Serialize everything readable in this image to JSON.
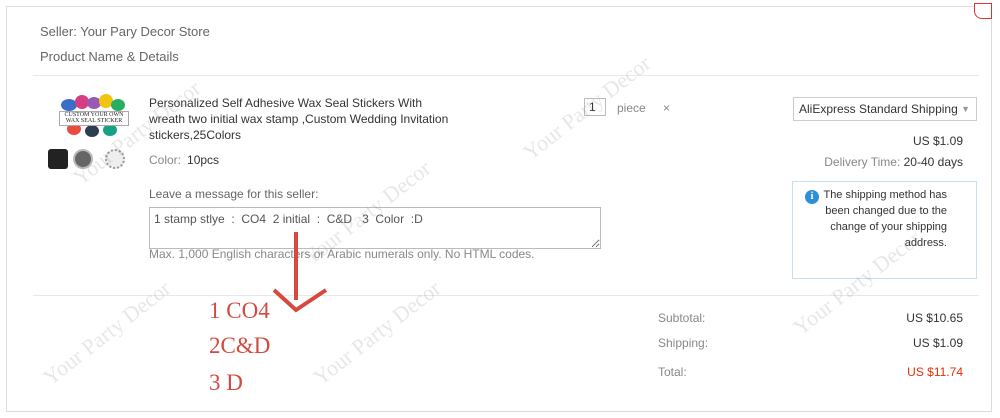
{
  "order": {
    "seller_label": "Seller: Your Pary Decor Store",
    "product_header": "Product Name & Details",
    "title": "Personalized Self Adhesive Wax Seal Stickers With wreath two initial wax stamp ,Custom Wedding Invitation stickers,25Colors",
    "thumb_label": "CUSTOM YOUR OWN WAX SEAL STICKER",
    "color_label": "Color:",
    "color_value": "10pcs",
    "quantity": "1",
    "unit": "piece",
    "times": "×",
    "leave_message_label": "Leave a message for this seller:",
    "message": "1 stamp stlye  :  CO4  2 initial  :  C&D   3  Color  :D",
    "max_note": "Max. 1,000 English characters or Arabic numerals only. No HTML codes.",
    "shipping_method": "AliExpress Standard Shipping",
    "shipping_price": "US $1.09",
    "delivery_label": "Delivery Time:",
    "delivery_value": "20-40 days",
    "notice": "The shipping method has been changed due to the change of your shipping address.",
    "subtotal_label": "Subtotal:",
    "subtotal_value": "US $10.65",
    "shipping_label": "Shipping:",
    "shipping_value": "US $1.09",
    "total_label": "Total:",
    "total_value": "US $11.74"
  },
  "annotations": {
    "line1": "1 CO4",
    "line2": "2C&D",
    "line3": "3 D"
  },
  "watermark": "Your Party Decor",
  "colors": {
    "accent": "#e62e04",
    "info": "#2f8fd6",
    "handwriting": "#d44a3e"
  }
}
